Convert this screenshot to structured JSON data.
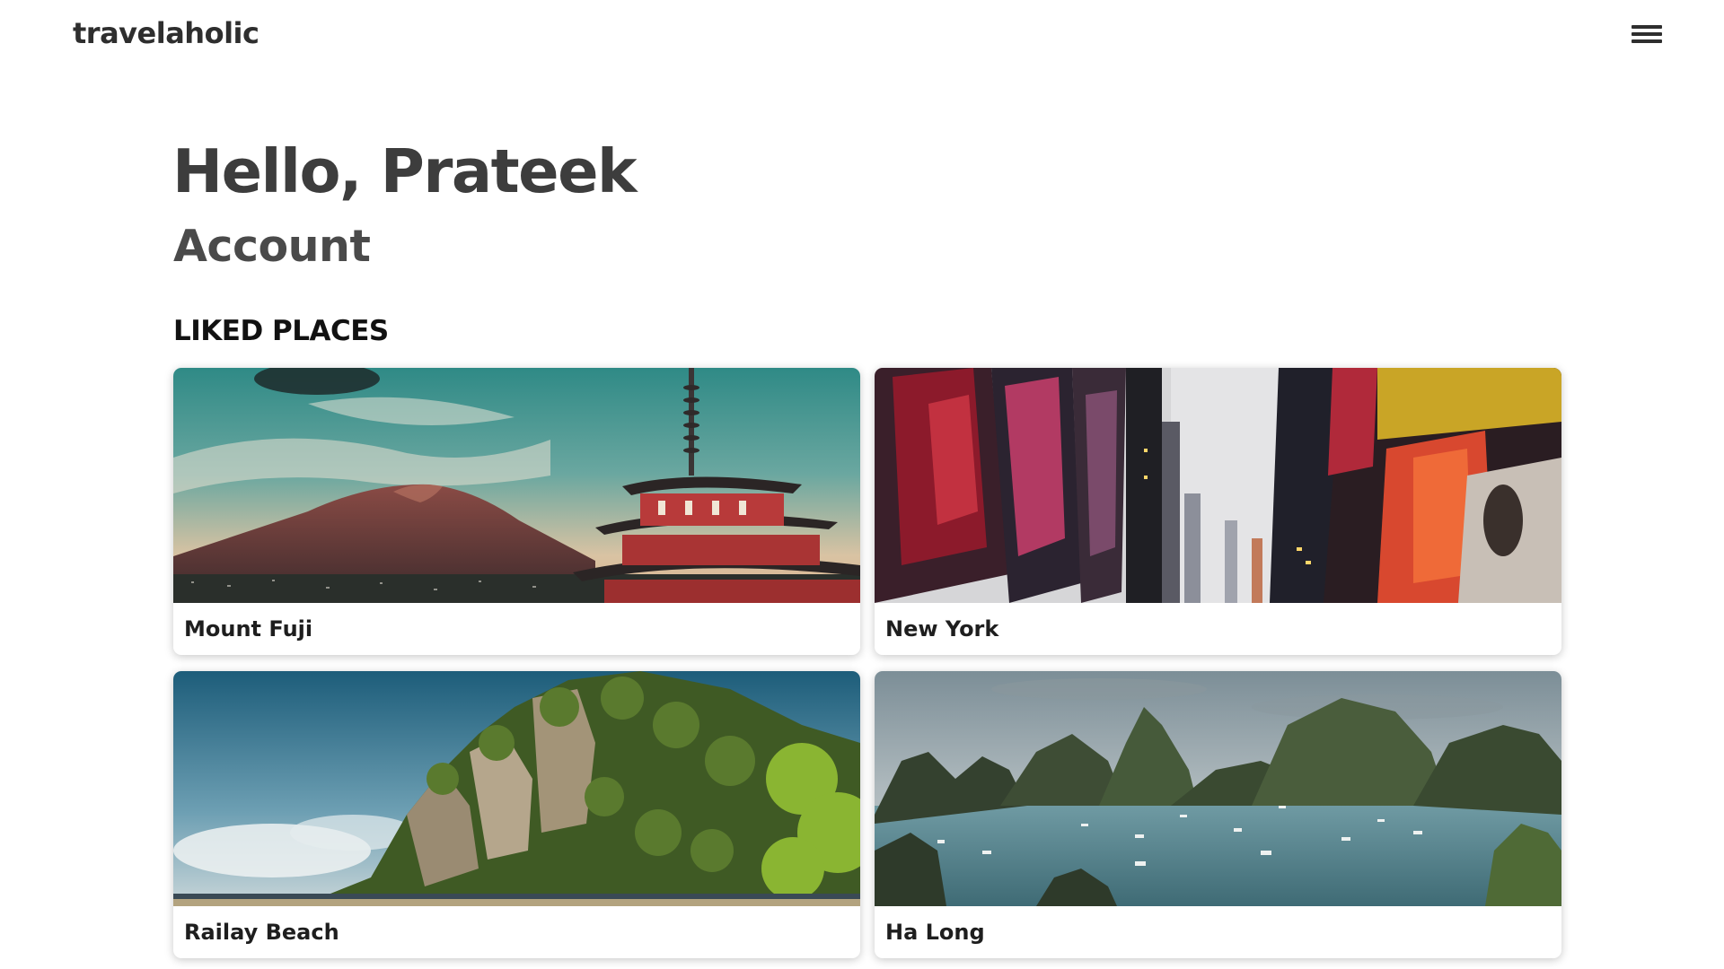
{
  "header": {
    "logo": "travelaholic",
    "menu_icon": "hamburger-menu-icon"
  },
  "main": {
    "greeting": "Hello, Prateek",
    "subtitle": "Account",
    "section_title": "LIKED PLACES",
    "places": [
      {
        "name": "Mount Fuji",
        "image": "mount-fuji-pagoda-photo"
      },
      {
        "name": "New York",
        "image": "new-york-times-square-photo"
      },
      {
        "name": "Railay Beach",
        "image": "railay-beach-cliff-photo"
      },
      {
        "name": "Ha Long",
        "image": "ha-long-bay-photo"
      }
    ]
  },
  "colors": {
    "background": "#ffffff",
    "text_dark": "#3d3d3d",
    "heading_black": "#111111"
  }
}
